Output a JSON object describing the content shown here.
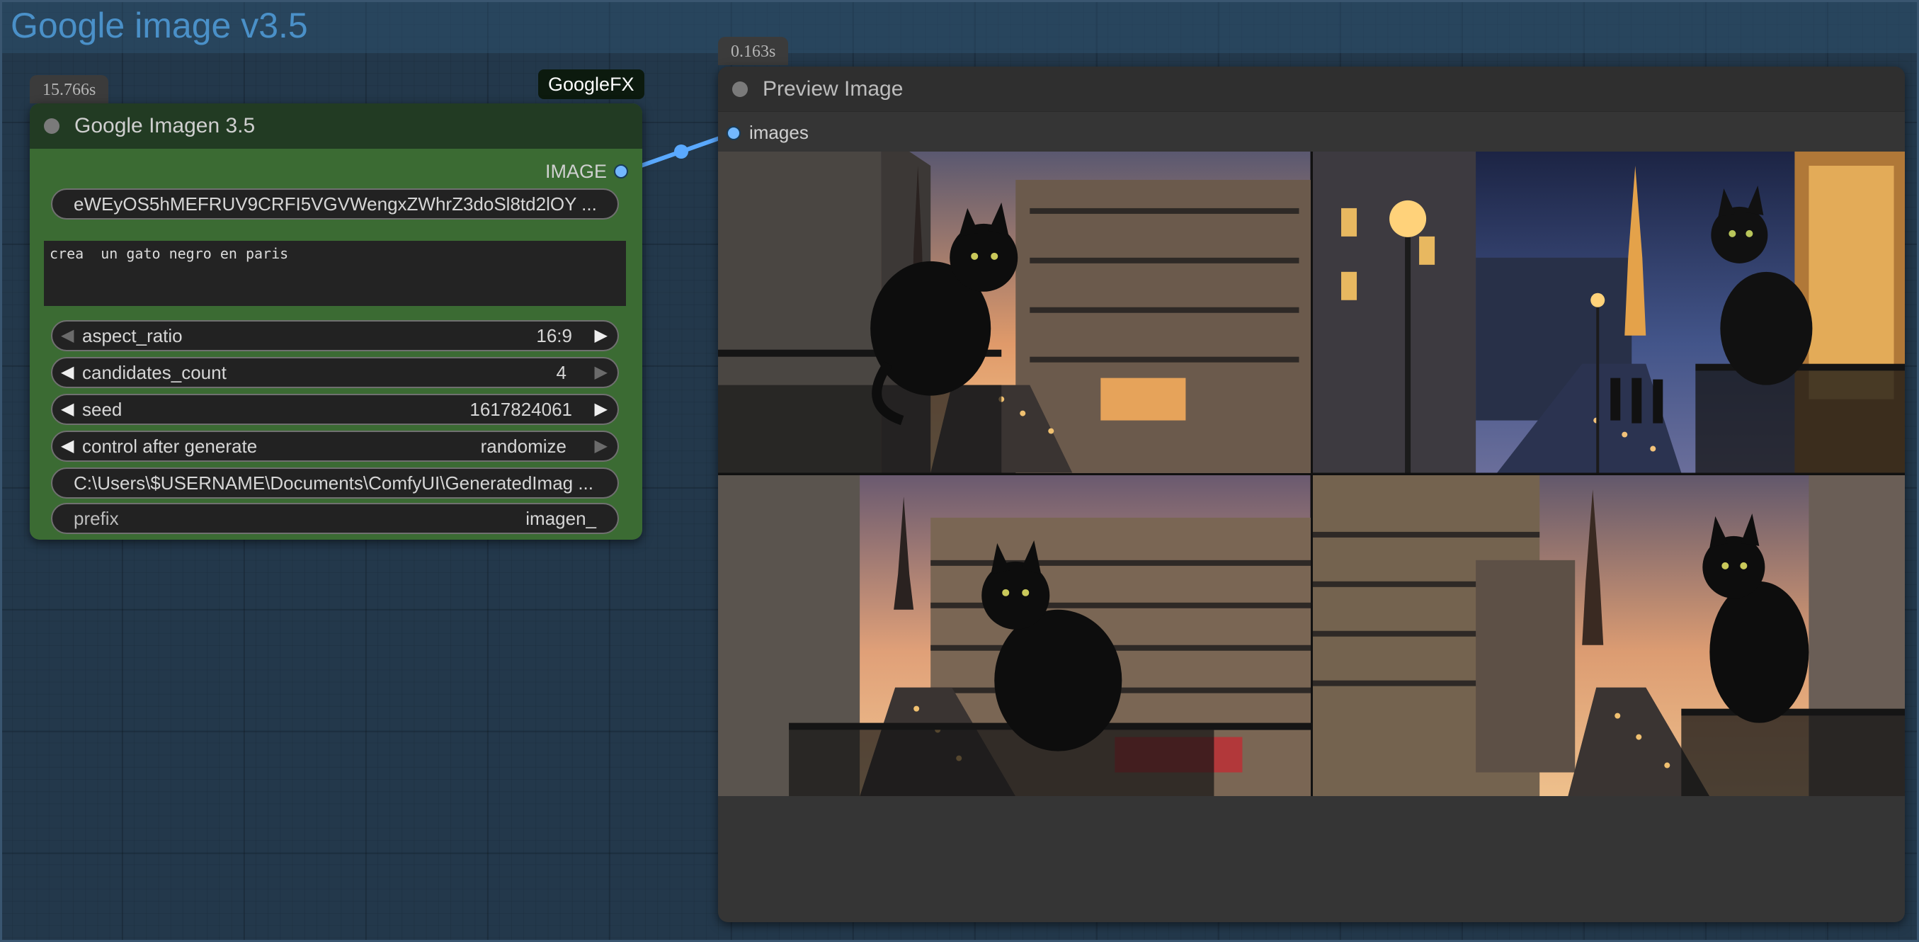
{
  "group": {
    "title": "Google image v3.5"
  },
  "imagen_node": {
    "timing": "15.766s",
    "badge": "GoogleFX",
    "title": "Google Imagen 3.5",
    "output_label": "IMAGE",
    "api_key": "eWEyOS5hMEFRUV9CRFI5VGVWengxZWhrZ3doSl8td2lOY ...",
    "prompt": "crea  un gato negro en paris",
    "widgets": {
      "aspect_ratio": {
        "label": "aspect_ratio",
        "value": "16:9"
      },
      "candidates_count": {
        "label": "candidates_count",
        "value": "4"
      },
      "seed": {
        "label": "seed",
        "value": "1617824061"
      },
      "control_after_generate": {
        "label": "control after generate",
        "value": "randomize"
      },
      "output_path": "C:\\Users\\$USERNAME\\Documents\\ComfyUI\\GeneratedImag ...",
      "prefix": {
        "label": "prefix",
        "value": "imagen_"
      }
    }
  },
  "preview_node": {
    "timing": "0.163s",
    "title": "Preview Image",
    "input_label": "images",
    "images_count": 4
  },
  "colors": {
    "link": "#5aa9ff",
    "imagen_body": "#3b6b33",
    "imagen_title": "#223b23",
    "group_title": "#4a90c8"
  },
  "icons": [
    "left-arrow-icon",
    "right-arrow-icon",
    "node-status-dot-icon",
    "slot-dot-icon"
  ]
}
